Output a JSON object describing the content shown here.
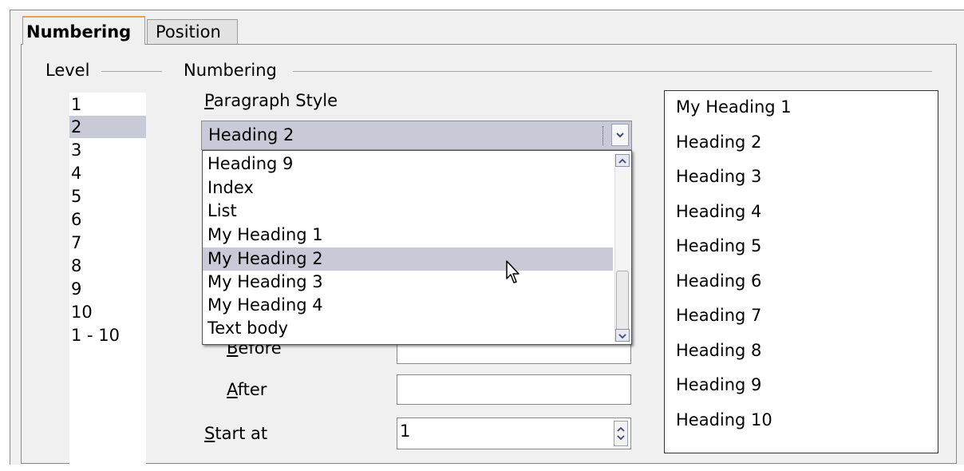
{
  "tabs": [
    {
      "label": "Numbering",
      "active": true
    },
    {
      "label": "Position",
      "active": false
    }
  ],
  "level_frame": {
    "title": "Level",
    "items": [
      "1",
      "2",
      "3",
      "4",
      "5",
      "6",
      "7",
      "8",
      "9",
      "10",
      "1 - 10"
    ],
    "selected": "2"
  },
  "numbering_frame": {
    "title": "Numbering",
    "paragraph_style_label": "Paragraph Style",
    "paragraph_style_value": "Heading 2",
    "dropdown_items": [
      "Heading 9",
      "Index",
      "List",
      "My Heading 1",
      "My Heading 2",
      "My Heading 3",
      "My Heading 4",
      "Text body"
    ],
    "dropdown_highlighted": "My Heading 2",
    "before_label": "Before",
    "before_value": "",
    "after_label": "After",
    "after_value": "",
    "start_at_label": "Start at",
    "start_at_value": "1"
  },
  "preview": {
    "items": [
      "My Heading 1",
      "Heading 2",
      "Heading 3",
      "Heading 4",
      "Heading 5",
      "Heading 6",
      "Heading 7",
      "Heading 8",
      "Heading 9",
      "Heading 10"
    ]
  },
  "colors": {
    "selection": "#c9cad8",
    "active_tab_accent": "#e8a24a",
    "dialog_bg": "#f0f0f0"
  }
}
